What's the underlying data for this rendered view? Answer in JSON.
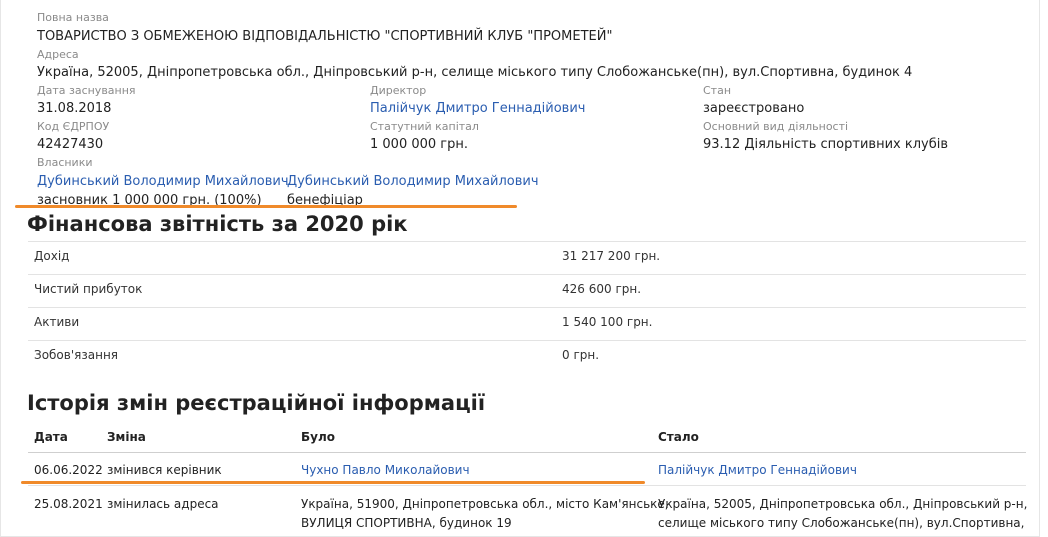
{
  "company": {
    "full_name_label": "Повна назва",
    "full_name": "ТОВАРИСТВО З ОБМЕЖЕНОЮ ВІДПОВІДАЛЬНІСТЮ \"СПОРТИВНИЙ КЛУБ \"ПРОМЕТЕЙ\"",
    "address_label": "Адреса",
    "address": "Україна, 52005, Дніпропетровська обл., Дніпровський р-н, селище міського типу Слобожанське(пн), вул.Спортивна, будинок 4",
    "founded_label": "Дата заснування",
    "founded": "31.08.2018",
    "director_label": "Директор",
    "director": "Палійчук Дмитро Геннадійович",
    "status_label": "Стан",
    "status": "зареєстровано",
    "edrpou_label": "Код ЄДРПОУ",
    "edrpou": "42427430",
    "capital_label": "Статутний капітал",
    "capital": "1 000 000 грн.",
    "activity_label": "Основний вид діяльності",
    "activity": "93.12 Діяльність спортивних клубів",
    "owners_label": "Власники",
    "owners": [
      {
        "name": "Дубинський Володимир Михайлович",
        "role": "засновник 1 000 000 грн. (100%)"
      },
      {
        "name": "Дубинський Володимир Михайлович",
        "role": "бенефіціар"
      }
    ]
  },
  "finance": {
    "title": "Фінансова звітність за 2020 рік",
    "rows": [
      {
        "label": "Дохід",
        "value": "31 217 200 грн."
      },
      {
        "label": "Чистий прибуток",
        "value": "426 600 грн."
      },
      {
        "label": "Активи",
        "value": "1 540 100 грн."
      },
      {
        "label": "Зобов'язання",
        "value": "0 грн."
      }
    ]
  },
  "history": {
    "title": "Історія змін реєстраційної інформації",
    "headers": {
      "date": "Дата",
      "change": "Зміна",
      "was": "Було",
      "became": "Стало"
    },
    "rows": [
      {
        "date": "06.06.2022",
        "change": "змінився керівник",
        "was": "Чухно Павло Миколайович",
        "became": "Палійчук Дмитро Геннадійович"
      },
      {
        "date": "25.08.2021",
        "change": "змінилась адреса",
        "was_1": "Україна, 51900, Дніпропетровська обл., місто Кам'янське,",
        "was_2": "ВУЛИЦЯ СПОРТИВНА, будинок 19",
        "became_1": "Україна, 52005, Дніпропетровська обл., Дніпровський р-н,",
        "became_2": "селище міського типу Слобожанське(пн), вул.Спортивна,"
      }
    ]
  },
  "colors": {
    "link": "#2a5db0",
    "highlight": "#f08a2a"
  }
}
